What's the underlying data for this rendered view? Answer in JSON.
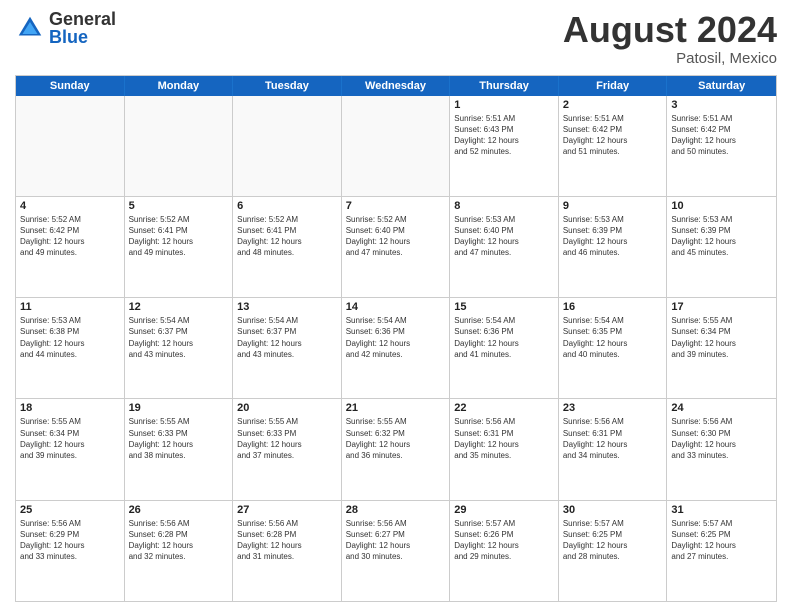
{
  "logo": {
    "general": "General",
    "blue": "Blue"
  },
  "title": "August 2024",
  "location": "Patosil, Mexico",
  "days": [
    "Sunday",
    "Monday",
    "Tuesday",
    "Wednesday",
    "Thursday",
    "Friday",
    "Saturday"
  ],
  "rows": [
    [
      {
        "day": "",
        "empty": true
      },
      {
        "day": "",
        "empty": true
      },
      {
        "day": "",
        "empty": true
      },
      {
        "day": "",
        "empty": true
      },
      {
        "day": "1",
        "lines": [
          "Sunrise: 5:51 AM",
          "Sunset: 6:43 PM",
          "Daylight: 12 hours",
          "and 52 minutes."
        ]
      },
      {
        "day": "2",
        "lines": [
          "Sunrise: 5:51 AM",
          "Sunset: 6:42 PM",
          "Daylight: 12 hours",
          "and 51 minutes."
        ]
      },
      {
        "day": "3",
        "lines": [
          "Sunrise: 5:51 AM",
          "Sunset: 6:42 PM",
          "Daylight: 12 hours",
          "and 50 minutes."
        ]
      }
    ],
    [
      {
        "day": "4",
        "lines": [
          "Sunrise: 5:52 AM",
          "Sunset: 6:42 PM",
          "Daylight: 12 hours",
          "and 49 minutes."
        ]
      },
      {
        "day": "5",
        "lines": [
          "Sunrise: 5:52 AM",
          "Sunset: 6:41 PM",
          "Daylight: 12 hours",
          "and 49 minutes."
        ]
      },
      {
        "day": "6",
        "lines": [
          "Sunrise: 5:52 AM",
          "Sunset: 6:41 PM",
          "Daylight: 12 hours",
          "and 48 minutes."
        ]
      },
      {
        "day": "7",
        "lines": [
          "Sunrise: 5:52 AM",
          "Sunset: 6:40 PM",
          "Daylight: 12 hours",
          "and 47 minutes."
        ]
      },
      {
        "day": "8",
        "lines": [
          "Sunrise: 5:53 AM",
          "Sunset: 6:40 PM",
          "Daylight: 12 hours",
          "and 47 minutes."
        ]
      },
      {
        "day": "9",
        "lines": [
          "Sunrise: 5:53 AM",
          "Sunset: 6:39 PM",
          "Daylight: 12 hours",
          "and 46 minutes."
        ]
      },
      {
        "day": "10",
        "lines": [
          "Sunrise: 5:53 AM",
          "Sunset: 6:39 PM",
          "Daylight: 12 hours",
          "and 45 minutes."
        ]
      }
    ],
    [
      {
        "day": "11",
        "lines": [
          "Sunrise: 5:53 AM",
          "Sunset: 6:38 PM",
          "Daylight: 12 hours",
          "and 44 minutes."
        ]
      },
      {
        "day": "12",
        "lines": [
          "Sunrise: 5:54 AM",
          "Sunset: 6:37 PM",
          "Daylight: 12 hours",
          "and 43 minutes."
        ]
      },
      {
        "day": "13",
        "lines": [
          "Sunrise: 5:54 AM",
          "Sunset: 6:37 PM",
          "Daylight: 12 hours",
          "and 43 minutes."
        ]
      },
      {
        "day": "14",
        "lines": [
          "Sunrise: 5:54 AM",
          "Sunset: 6:36 PM",
          "Daylight: 12 hours",
          "and 42 minutes."
        ]
      },
      {
        "day": "15",
        "lines": [
          "Sunrise: 5:54 AM",
          "Sunset: 6:36 PM",
          "Daylight: 12 hours",
          "and 41 minutes."
        ]
      },
      {
        "day": "16",
        "lines": [
          "Sunrise: 5:54 AM",
          "Sunset: 6:35 PM",
          "Daylight: 12 hours",
          "and 40 minutes."
        ]
      },
      {
        "day": "17",
        "lines": [
          "Sunrise: 5:55 AM",
          "Sunset: 6:34 PM",
          "Daylight: 12 hours",
          "and 39 minutes."
        ]
      }
    ],
    [
      {
        "day": "18",
        "lines": [
          "Sunrise: 5:55 AM",
          "Sunset: 6:34 PM",
          "Daylight: 12 hours",
          "and 39 minutes."
        ]
      },
      {
        "day": "19",
        "lines": [
          "Sunrise: 5:55 AM",
          "Sunset: 6:33 PM",
          "Daylight: 12 hours",
          "and 38 minutes."
        ]
      },
      {
        "day": "20",
        "lines": [
          "Sunrise: 5:55 AM",
          "Sunset: 6:33 PM",
          "Daylight: 12 hours",
          "and 37 minutes."
        ]
      },
      {
        "day": "21",
        "lines": [
          "Sunrise: 5:55 AM",
          "Sunset: 6:32 PM",
          "Daylight: 12 hours",
          "and 36 minutes."
        ]
      },
      {
        "day": "22",
        "lines": [
          "Sunrise: 5:56 AM",
          "Sunset: 6:31 PM",
          "Daylight: 12 hours",
          "and 35 minutes."
        ]
      },
      {
        "day": "23",
        "lines": [
          "Sunrise: 5:56 AM",
          "Sunset: 6:31 PM",
          "Daylight: 12 hours",
          "and 34 minutes."
        ]
      },
      {
        "day": "24",
        "lines": [
          "Sunrise: 5:56 AM",
          "Sunset: 6:30 PM",
          "Daylight: 12 hours",
          "and 33 minutes."
        ]
      }
    ],
    [
      {
        "day": "25",
        "lines": [
          "Sunrise: 5:56 AM",
          "Sunset: 6:29 PM",
          "Daylight: 12 hours",
          "and 33 minutes."
        ]
      },
      {
        "day": "26",
        "lines": [
          "Sunrise: 5:56 AM",
          "Sunset: 6:28 PM",
          "Daylight: 12 hours",
          "and 32 minutes."
        ]
      },
      {
        "day": "27",
        "lines": [
          "Sunrise: 5:56 AM",
          "Sunset: 6:28 PM",
          "Daylight: 12 hours",
          "and 31 minutes."
        ]
      },
      {
        "day": "28",
        "lines": [
          "Sunrise: 5:56 AM",
          "Sunset: 6:27 PM",
          "Daylight: 12 hours",
          "and 30 minutes."
        ]
      },
      {
        "day": "29",
        "lines": [
          "Sunrise: 5:57 AM",
          "Sunset: 6:26 PM",
          "Daylight: 12 hours",
          "and 29 minutes."
        ]
      },
      {
        "day": "30",
        "lines": [
          "Sunrise: 5:57 AM",
          "Sunset: 6:25 PM",
          "Daylight: 12 hours",
          "and 28 minutes."
        ]
      },
      {
        "day": "31",
        "lines": [
          "Sunrise: 5:57 AM",
          "Sunset: 6:25 PM",
          "Daylight: 12 hours",
          "and 27 minutes."
        ]
      }
    ]
  ]
}
